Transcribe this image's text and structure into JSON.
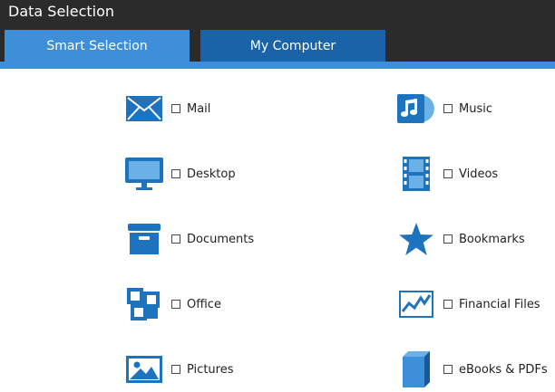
{
  "window": {
    "title": "Data Selection"
  },
  "tabs": [
    {
      "label": "Smart Selection",
      "active": true
    },
    {
      "label": "My Computer",
      "active": false
    }
  ],
  "colors": {
    "titlebar": "#2b2b2b",
    "tab_active": "#3d8fd9",
    "tab_inactive": "#1a63a8",
    "icon": "#1e73be"
  },
  "categories": [
    {
      "label": "Mail",
      "icon": "envelope-icon",
      "checked": false
    },
    {
      "label": "Music",
      "icon": "music-icon",
      "checked": false
    },
    {
      "label": "Desktop",
      "icon": "monitor-icon",
      "checked": false
    },
    {
      "label": "Videos",
      "icon": "film-icon",
      "checked": false
    },
    {
      "label": "Documents",
      "icon": "archive-box-icon",
      "checked": false
    },
    {
      "label": "Bookmarks",
      "icon": "star-icon",
      "checked": false
    },
    {
      "label": "Office",
      "icon": "office-icon",
      "checked": false
    },
    {
      "label": "Financial Files",
      "icon": "chart-icon",
      "checked": false
    },
    {
      "label": "Pictures",
      "icon": "picture-icon",
      "checked": false
    },
    {
      "label": "eBooks & PDFs",
      "icon": "book-icon",
      "checked": false
    }
  ]
}
